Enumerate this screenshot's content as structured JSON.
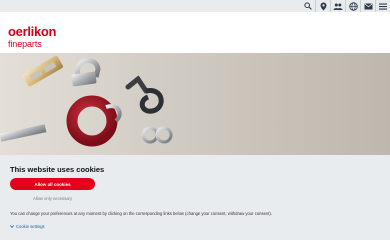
{
  "brand": {
    "name": "oerlikon",
    "sub": "fineparts",
    "color": "#d4001a"
  },
  "topbar": {
    "icons": [
      "search-icon",
      "location-icon",
      "people-icon",
      "globe-icon",
      "mail-icon",
      "menu-icon"
    ]
  },
  "cookie_banner": {
    "title": "This website uses cookies",
    "allow_all_label": "Allow all cookies",
    "allow_necessary_label": "Allow only necessary",
    "info_text": "You can change your preferences at any moment by clicking on the corresponding links below (change your consent, withdraw your consent).",
    "settings_label": "Cookie settings",
    "accent": "#e4001b"
  }
}
